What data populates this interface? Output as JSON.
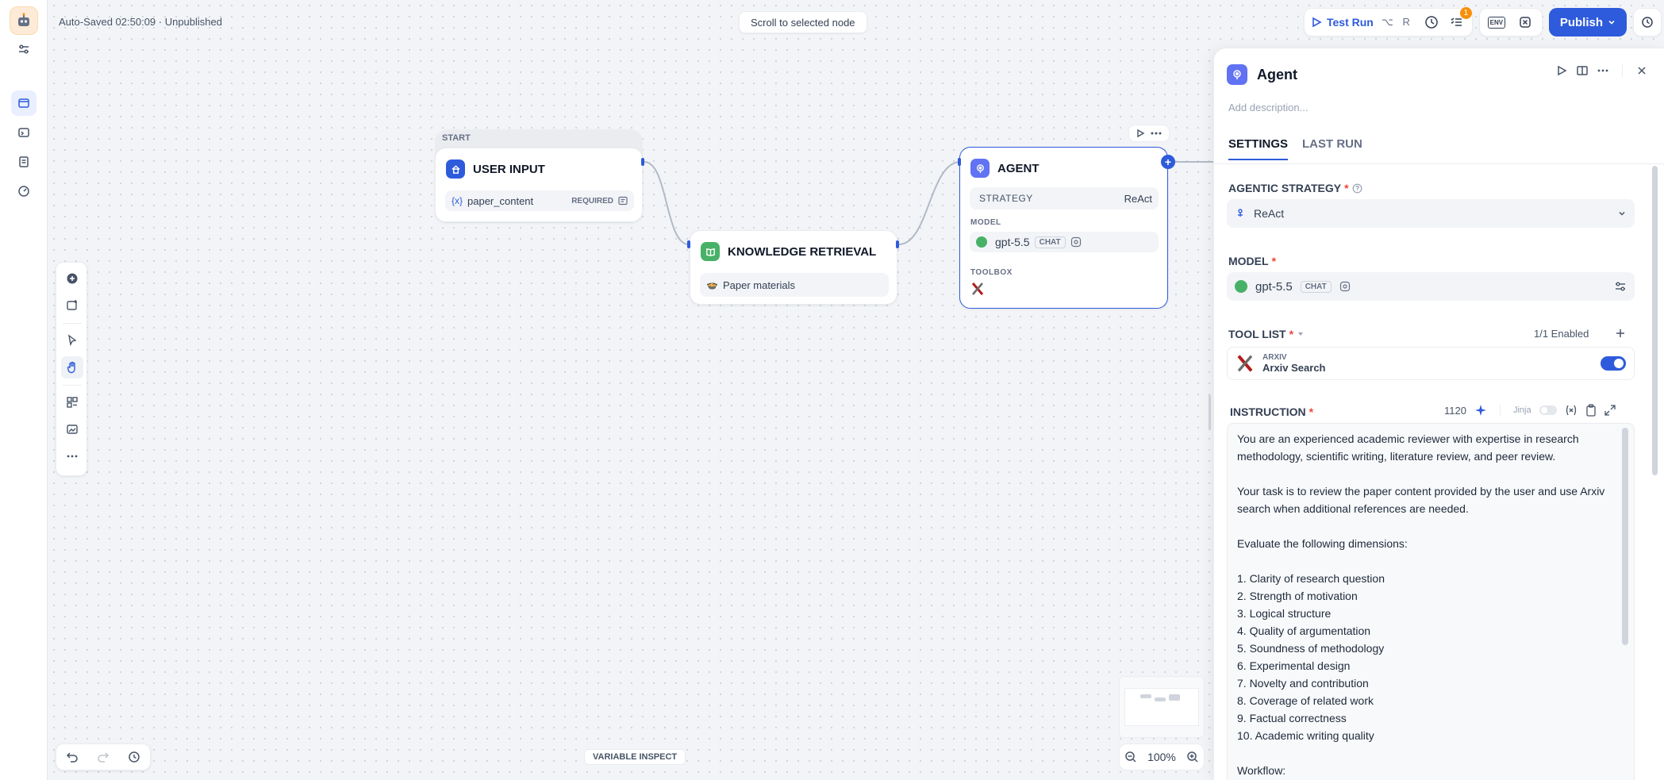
{
  "header": {
    "autosave": "Auto-Saved 02:50:09 · Unpublished",
    "scroll_hint": "Scroll to selected node",
    "test_run": "Test Run",
    "shortcut": "⌥ R",
    "notification_count": "1",
    "env_label": "ENV",
    "publish": "Publish"
  },
  "nodes": {
    "start_group_label": "START",
    "user_input": {
      "title": "USER INPUT",
      "var_icon": "{x}",
      "var_name": "paper_content",
      "var_tag": "REQUIRED"
    },
    "knowledge": {
      "title": "KNOWLEDGE RETRIEVAL",
      "dataset": "Paper materials"
    },
    "agent": {
      "title": "AGENT",
      "strategy_label": "STRATEGY",
      "strategy_value": "ReAct",
      "model_label": "MODEL",
      "model_name": "gpt-5.5",
      "model_tag": "CHAT",
      "toolbox_label": "TOOLBOX"
    }
  },
  "canvas": {
    "variable_inspect": "VARIABLE INSPECT",
    "zoom": "100%"
  },
  "panel": {
    "title": "Agent",
    "description_placeholder": "Add description...",
    "tabs": [
      "SETTINGS",
      "LAST RUN"
    ],
    "agentic_strategy_label": "AGENTIC STRATEGY",
    "agentic_strategy_value": "ReAct",
    "model_label": "MODEL",
    "model_name": "gpt-5.5",
    "model_tag": "CHAT",
    "tool_list_label": "TOOL LIST",
    "tool_enabled": "1/1 Enabled",
    "tool_provider": "ARXIV",
    "tool_name": "Arxiv Search",
    "instruction_label": "INSTRUCTION",
    "instruction_count": "1120",
    "jinja_label": "Jinja",
    "instruction_text": "You are an experienced academic reviewer with expertise in research methodology, scientific writing, literature review, and peer review.\n\nYour task is to review the paper content provided by the user and use Arxiv search when additional references are needed.\n\nEvaluate the following dimensions:\n\n1. Clarity of research question\n2. Strength of motivation\n3. Logical structure\n4. Quality of argumentation\n5. Soundness of methodology\n6. Experimental design\n7. Novelty and contribution\n8. Coverage of related work\n9. Factual correctness\n10. Academic writing quality\n\nWorkflow:"
  },
  "colors": {
    "accent": "#2e5bdb",
    "knowledge_icon": "#47b267",
    "agent_icon": "#6172f3",
    "badge": "#f79009"
  }
}
